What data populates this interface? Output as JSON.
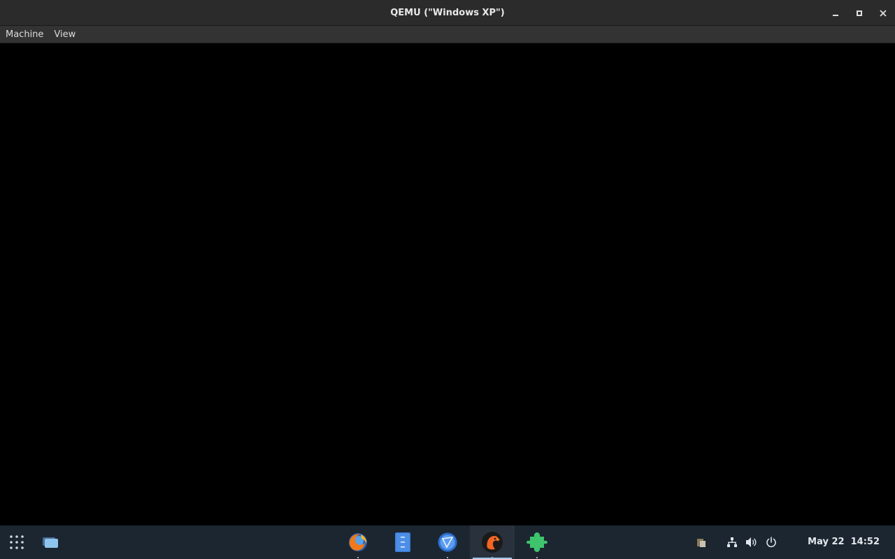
{
  "window": {
    "title": "QEMU (\"Windows XP\")",
    "controls": [
      "minimize-icon",
      "maximize-icon",
      "close-icon"
    ]
  },
  "menubar": {
    "items": [
      {
        "label": "Machine"
      },
      {
        "label": "View"
      }
    ]
  },
  "taskbar": {
    "left": [
      "app-grid-icon",
      "show-desktop-icon"
    ],
    "apps": [
      {
        "name": "firefox-icon",
        "running": true
      },
      {
        "name": "text-editor-icon",
        "running": false
      },
      {
        "name": "web-browser-icon",
        "running": true
      },
      {
        "name": "qemu-icon",
        "running": true,
        "active": true
      },
      {
        "name": "extension-puzzle-icon",
        "running": true
      }
    ],
    "tray": [
      "clipboard-icon",
      "network-icon",
      "volume-icon",
      "power-icon"
    ],
    "clock": {
      "date": "May 22",
      "time": "14:52"
    }
  },
  "colors": {
    "titlebar": "#2b2b2b",
    "menubar": "#333333",
    "display": "#000000",
    "taskbar": "#1c2630",
    "active_indicator": "#9fc6e8"
  }
}
